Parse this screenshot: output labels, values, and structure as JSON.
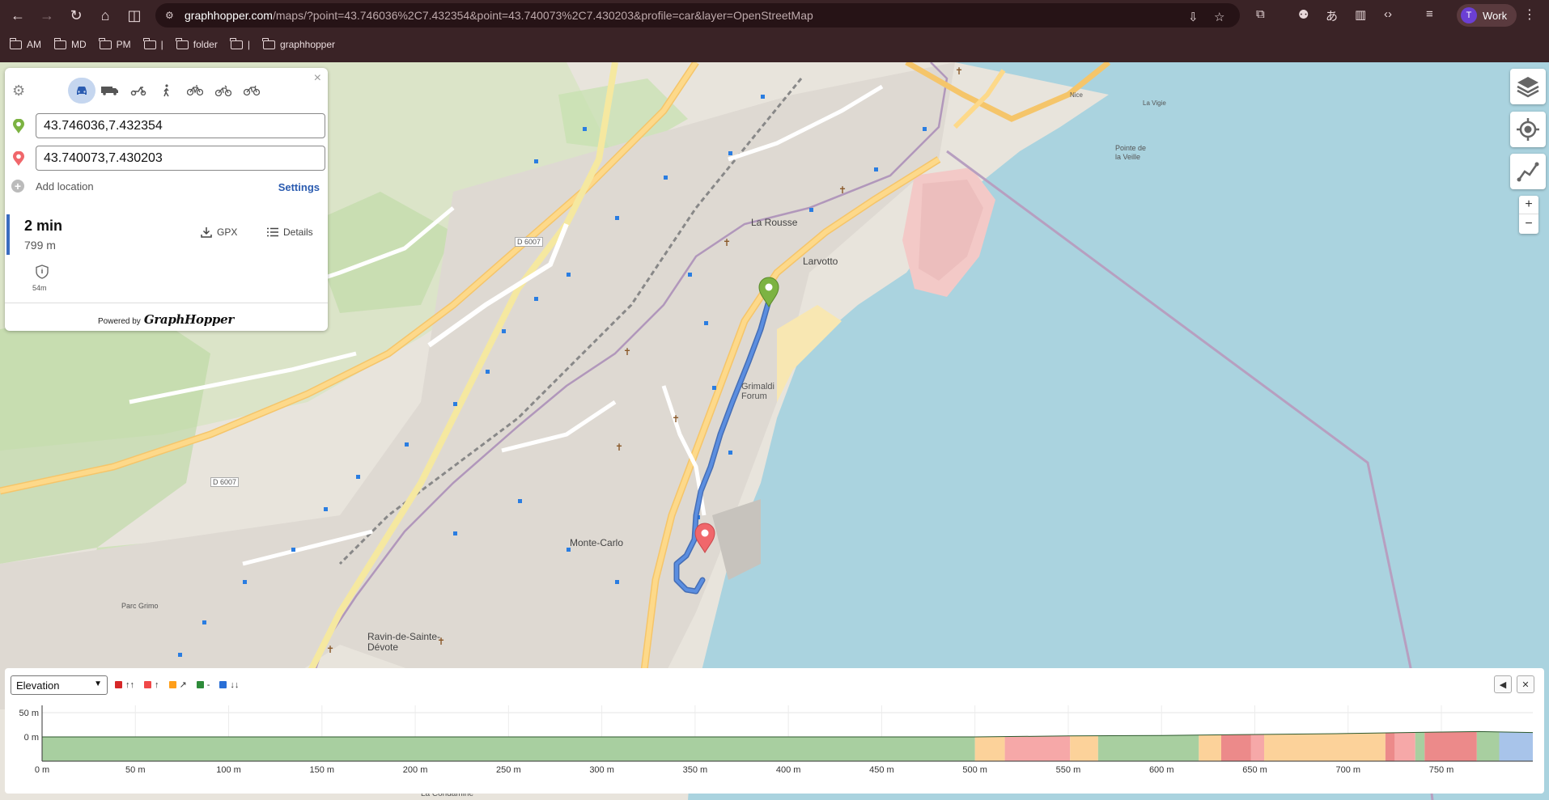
{
  "browser": {
    "url_host": "graphhopper.com",
    "url_rest": "/maps/?point=43.746036%2C7.432354&point=43.740073%2C7.430203&profile=car&layer=OpenStreetMap",
    "profile_initial": "T",
    "profile_name": "Work"
  },
  "bookmarks": [
    {
      "label": "AM"
    },
    {
      "label": "MD"
    },
    {
      "label": "PM"
    },
    {
      "label": "|"
    },
    {
      "label": "folder"
    },
    {
      "label": "|"
    },
    {
      "label": "graphhopper"
    }
  ],
  "panel": {
    "close": "×",
    "vehicles": [
      {
        "name": "car-icon",
        "glyph": "🚗",
        "active": true
      },
      {
        "name": "truck-icon",
        "glyph": "🚚",
        "active": false
      },
      {
        "name": "scooter-icon",
        "glyph": "🛵",
        "active": false
      },
      {
        "name": "walk-icon",
        "glyph": "🚶",
        "active": false
      },
      {
        "name": "bike-icon",
        "glyph": "🚲",
        "active": false
      },
      {
        "name": "mountain-bike-icon",
        "glyph": "🚵",
        "active": false
      },
      {
        "name": "racing-bike-icon",
        "glyph": "🚴",
        "active": false
      }
    ],
    "from_value": "43.746036,7.432354",
    "to_value": "43.740073,7.430203",
    "add_location": "Add location",
    "settings": "Settings",
    "route": {
      "time": "2 min",
      "distance": "799 m",
      "gpx": "GPX",
      "details": "Details",
      "toll_value": "54m"
    },
    "powered_by": "Powered by",
    "brand": "GraphHopper"
  },
  "map_labels": {
    "la_rousse": "La Rousse",
    "larvotto": "Larvotto",
    "monte_carlo": "Monte-Carlo",
    "ravin": "Ravin-de-Sainte-Dévote",
    "grimaldi": "Grimaldi Forum",
    "pointe": "Pointe de la Veille",
    "parc_grimo": "Parc Grimo",
    "d6007a": "D 6007",
    "d6007b": "D 6007",
    "la_condamine": "La Condamine",
    "nice": "Nice",
    "la_vigie": "La Vigie"
  },
  "elevation": {
    "select_value": "Elevation",
    "legend": [
      {
        "label": "↑↑",
        "color": "#d62728"
      },
      {
        "label": "↑",
        "color": "#f04848"
      },
      {
        "label": "↗",
        "color": "#ff9f1a"
      },
      {
        "label": "-",
        "color": "#2e8b3a"
      },
      {
        "label": "↓↓",
        "color": "#2a6fd6"
      }
    ],
    "collapse_glyph": "◀",
    "close_glyph": "✕",
    "y_ticks": [
      "50 m",
      "0 m"
    ],
    "x_ticks": [
      "0 m",
      "50 m",
      "100 m",
      "150 m",
      "200 m",
      "250 m",
      "300 m",
      "350 m",
      "400 m",
      "450 m",
      "500 m",
      "550 m",
      "600 m",
      "650 m",
      "700 m",
      "750 m"
    ]
  },
  "chart_data": {
    "type": "area",
    "title": "",
    "xlabel": "",
    "ylabel": "",
    "xlim": [
      0,
      799
    ],
    "ylim": [
      -50,
      65
    ],
    "x": [
      0,
      100,
      200,
      300,
      400,
      500,
      550,
      600,
      650,
      700,
      750,
      770,
      799
    ],
    "y": [
      0,
      0,
      0,
      0,
      0,
      0,
      2,
      3,
      5,
      7,
      10,
      11,
      9
    ],
    "segments": [
      {
        "from": 0,
        "to": 500,
        "color": "#a8cfa0"
      },
      {
        "from": 500,
        "to": 516,
        "color": "#fcd29a"
      },
      {
        "from": 516,
        "to": 551,
        "color": "#f6a8a8"
      },
      {
        "from": 551,
        "to": 566,
        "color": "#fcd29a"
      },
      {
        "from": 566,
        "to": 620,
        "color": "#a8cfa0"
      },
      {
        "from": 620,
        "to": 632,
        "color": "#fcd29a"
      },
      {
        "from": 632,
        "to": 648,
        "color": "#ec8a8a"
      },
      {
        "from": 648,
        "to": 655,
        "color": "#f6a8a8"
      },
      {
        "from": 655,
        "to": 720,
        "color": "#fcd29a"
      },
      {
        "from": 720,
        "to": 725,
        "color": "#ec8a8a"
      },
      {
        "from": 725,
        "to": 736,
        "color": "#f6a8a8"
      },
      {
        "from": 736,
        "to": 741,
        "color": "#a8cfa0"
      },
      {
        "from": 741,
        "to": 769,
        "color": "#ec8a8a"
      },
      {
        "from": 769,
        "to": 781,
        "color": "#a8cfa0"
      },
      {
        "from": 781,
        "to": 799,
        "color": "#a8c4ea"
      }
    ],
    "grid": true
  }
}
